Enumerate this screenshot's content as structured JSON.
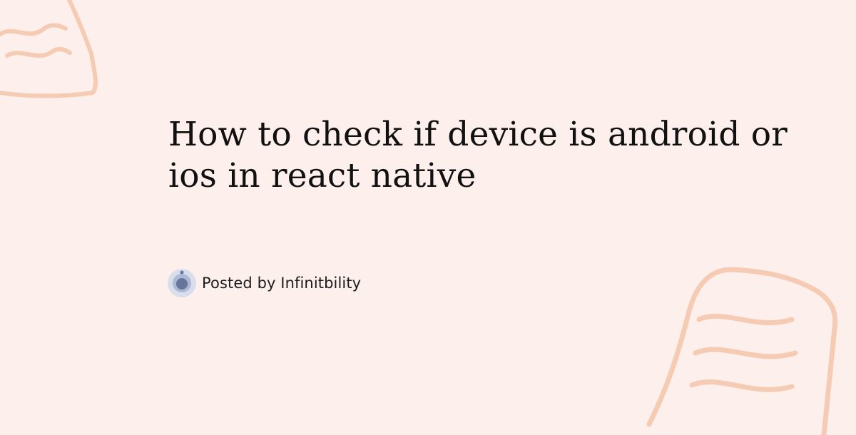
{
  "post": {
    "title": "How to check if device is android or ios in react native",
    "byline": "Posted by Infinitbility"
  },
  "theme": {
    "background": "#fdf0ec",
    "decoration": "#f5c7ad",
    "avatar_ring": "#d9deec",
    "avatar_dot": "#66759a"
  },
  "icons": {
    "decoration_top_left": "doodle-curve-shape",
    "decoration_bottom_right": "doodle-square-shape",
    "avatar": "infinitbility-avatar-icon"
  }
}
